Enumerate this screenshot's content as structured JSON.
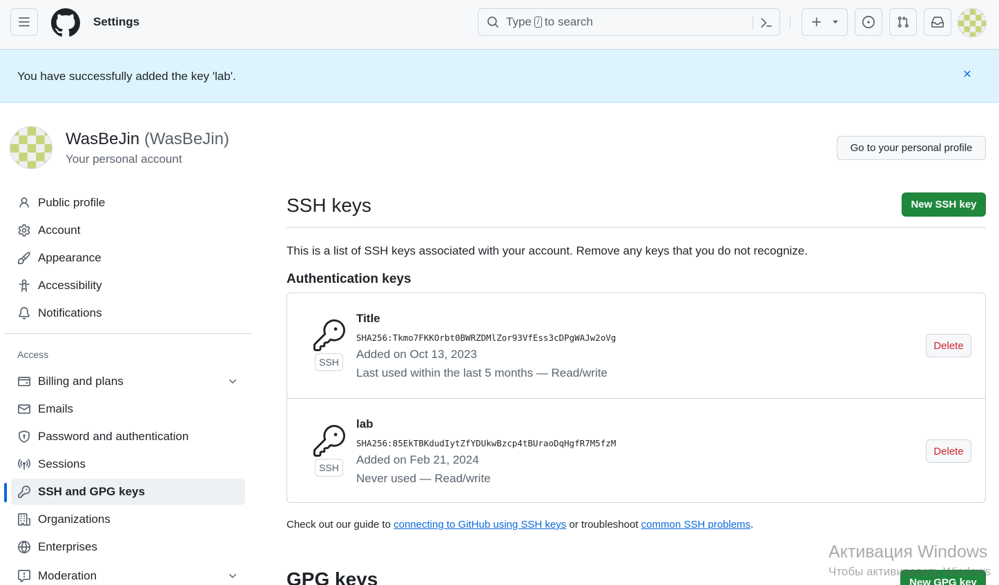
{
  "header": {
    "title": "Settings",
    "search_before": "Type",
    "search_key": "/",
    "search_after": "to search"
  },
  "flash": {
    "message": "You have successfully added the key 'lab'."
  },
  "account": {
    "name": "WasBeJin",
    "handle": "(WasBeJin)",
    "subtitle": "Your personal account",
    "profile_button": "Go to your personal profile"
  },
  "sidebar": {
    "items_top": [
      {
        "label": "Public profile",
        "icon": "person-icon"
      },
      {
        "label": "Account",
        "icon": "gear-icon"
      },
      {
        "label": "Appearance",
        "icon": "paintbrush-icon"
      },
      {
        "label": "Accessibility",
        "icon": "accessibility-icon"
      },
      {
        "label": "Notifications",
        "icon": "bell-icon"
      }
    ],
    "section_heading": "Access",
    "items_access": [
      {
        "label": "Billing and plans",
        "icon": "credit-card-icon"
      },
      {
        "label": "Emails",
        "icon": "mail-icon"
      },
      {
        "label": "Password and authentication",
        "icon": "shield-lock-icon"
      },
      {
        "label": "Sessions",
        "icon": "broadcast-icon"
      },
      {
        "label": "SSH and GPG keys",
        "icon": "key-icon"
      },
      {
        "label": "Organizations",
        "icon": "organization-icon"
      },
      {
        "label": "Enterprises",
        "icon": "globe-icon"
      },
      {
        "label": "Moderation",
        "icon": "report-icon"
      }
    ]
  },
  "main": {
    "title": "SSH keys",
    "new_ssh_button": "New SSH key",
    "description": "This is a list of SSH keys associated with your account. Remove any keys that you do not recognize.",
    "auth_heading": "Authentication keys",
    "keys": [
      {
        "title": "Title",
        "fingerprint": "SHA256:Tkmo7FKKOrbt0BWRZDMlZor93VfEss3cDPgWAJw2oVg",
        "added": "Added on Oct 13, 2023",
        "usage": "Last used within the last 5 months — Read/write",
        "badge": "SSH",
        "delete_label": "Delete"
      },
      {
        "title": "lab",
        "fingerprint": "SHA256:85EkTBKdudIytZfYDUkwBzcp4tBUraoDqHgfR7M5fzM",
        "added": "Added on Feb 21, 2024",
        "usage": "Never used — Read/write",
        "badge": "SSH",
        "delete_label": "Delete"
      }
    ],
    "guide": {
      "before": "Check out our guide to ",
      "link1": "connecting to GitHub using SSH keys",
      "middle": " or troubleshoot ",
      "link2": "common SSH problems",
      "after": "."
    },
    "gpg_title": "GPG keys",
    "new_gpg_button": "New GPG key"
  },
  "watermark": {
    "line1": "Активация Windows",
    "line2": "Чтобы активировать Windows"
  }
}
